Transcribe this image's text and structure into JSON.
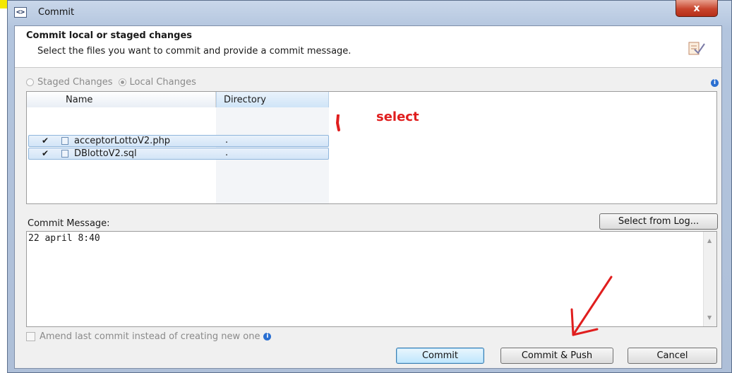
{
  "window": {
    "title": "Commit",
    "title_icon": "<>",
    "close_label": "x"
  },
  "header": {
    "title": "Commit local or staged changes",
    "description": "Select the files you want to commit and provide a commit message."
  },
  "change_mode": {
    "options": [
      "Staged Changes",
      "Local Changes"
    ],
    "selected": "Local Changes"
  },
  "file_table": {
    "columns": [
      "Name",
      "Directory"
    ],
    "rows": [
      {
        "checked": true,
        "check_glyph": "✔",
        "name": "acceptorLottoV2.php",
        "directory": "."
      },
      {
        "checked": true,
        "check_glyph": "✔",
        "name": "DBlottoV2.sql",
        "directory": "."
      }
    ]
  },
  "annotation": {
    "select_text": "select",
    "color": "#e01e1e"
  },
  "commit_message": {
    "label": "Commit Message:",
    "value": "22 april 8:40",
    "select_from_log_label": "Select from Log..."
  },
  "amend": {
    "label": "Amend last commit instead of creating new one",
    "checked": false
  },
  "buttons": {
    "commit": "Commit",
    "commit_push": "Commit & Push",
    "cancel": "Cancel"
  }
}
